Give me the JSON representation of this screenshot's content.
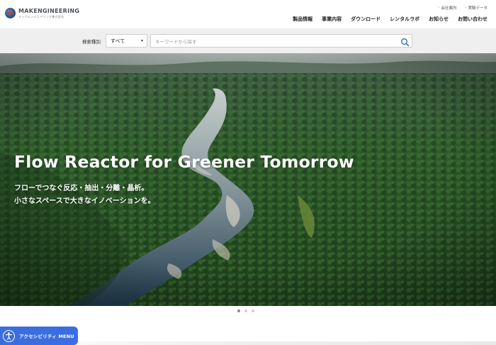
{
  "brand": {
    "name": "MAKENGINEERING",
    "subtitle": "マックエンジニアリング株式会社"
  },
  "utility_links": [
    {
      "label": "会社案内"
    },
    {
      "label": "実験データ"
    }
  ],
  "nav": {
    "items": [
      {
        "label": "製品情報"
      },
      {
        "label": "事業内容"
      },
      {
        "label": "ダウンロード"
      },
      {
        "label": "レンタルラボ"
      },
      {
        "label": "お知らせ"
      },
      {
        "label": "お問い合わせ"
      }
    ]
  },
  "search": {
    "type_label": "検索種別",
    "type_selected": "すべて",
    "placeholder": "キーワードから探す"
  },
  "hero": {
    "title": "Flow Reactor for Greener Tomorrow",
    "subtitle_line1": "フローでつなぐ反応・抽出・分離・晶析。",
    "subtitle_line2": "小さなスペースで大きなイノベーションを。"
  },
  "carousel": {
    "slide_count": 3,
    "active_index": 0
  },
  "accessibility": {
    "label": "アクセシビリティ MENU"
  },
  "colors": {
    "accent": "#3a6ee0",
    "forest": "#2f5a2a",
    "river": "#2a4a63"
  }
}
